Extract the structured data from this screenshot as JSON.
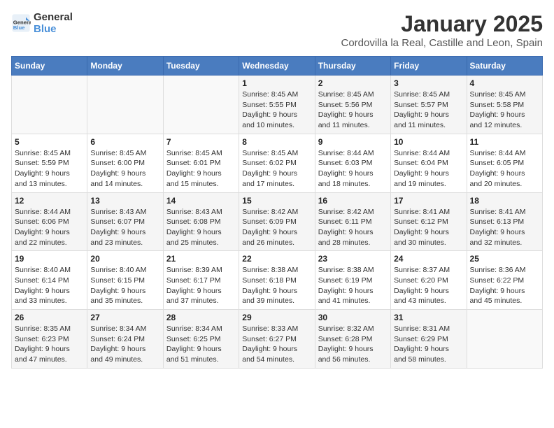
{
  "logo": {
    "line1": "General",
    "line2": "Blue"
  },
  "title": "January 2025",
  "subtitle": "Cordovilla la Real, Castille and Leon, Spain",
  "weekdays": [
    "Sunday",
    "Monday",
    "Tuesday",
    "Wednesday",
    "Thursday",
    "Friday",
    "Saturday"
  ],
  "weeks": [
    [
      {
        "day": "",
        "content": ""
      },
      {
        "day": "",
        "content": ""
      },
      {
        "day": "",
        "content": ""
      },
      {
        "day": "1",
        "content": "Sunrise: 8:45 AM\nSunset: 5:55 PM\nDaylight: 9 hours\nand 10 minutes."
      },
      {
        "day": "2",
        "content": "Sunrise: 8:45 AM\nSunset: 5:56 PM\nDaylight: 9 hours\nand 11 minutes."
      },
      {
        "day": "3",
        "content": "Sunrise: 8:45 AM\nSunset: 5:57 PM\nDaylight: 9 hours\nand 11 minutes."
      },
      {
        "day": "4",
        "content": "Sunrise: 8:45 AM\nSunset: 5:58 PM\nDaylight: 9 hours\nand 12 minutes."
      }
    ],
    [
      {
        "day": "5",
        "content": "Sunrise: 8:45 AM\nSunset: 5:59 PM\nDaylight: 9 hours\nand 13 minutes."
      },
      {
        "day": "6",
        "content": "Sunrise: 8:45 AM\nSunset: 6:00 PM\nDaylight: 9 hours\nand 14 minutes."
      },
      {
        "day": "7",
        "content": "Sunrise: 8:45 AM\nSunset: 6:01 PM\nDaylight: 9 hours\nand 15 minutes."
      },
      {
        "day": "8",
        "content": "Sunrise: 8:45 AM\nSunset: 6:02 PM\nDaylight: 9 hours\nand 17 minutes."
      },
      {
        "day": "9",
        "content": "Sunrise: 8:44 AM\nSunset: 6:03 PM\nDaylight: 9 hours\nand 18 minutes."
      },
      {
        "day": "10",
        "content": "Sunrise: 8:44 AM\nSunset: 6:04 PM\nDaylight: 9 hours\nand 19 minutes."
      },
      {
        "day": "11",
        "content": "Sunrise: 8:44 AM\nSunset: 6:05 PM\nDaylight: 9 hours\nand 20 minutes."
      }
    ],
    [
      {
        "day": "12",
        "content": "Sunrise: 8:44 AM\nSunset: 6:06 PM\nDaylight: 9 hours\nand 22 minutes."
      },
      {
        "day": "13",
        "content": "Sunrise: 8:43 AM\nSunset: 6:07 PM\nDaylight: 9 hours\nand 23 minutes."
      },
      {
        "day": "14",
        "content": "Sunrise: 8:43 AM\nSunset: 6:08 PM\nDaylight: 9 hours\nand 25 minutes."
      },
      {
        "day": "15",
        "content": "Sunrise: 8:42 AM\nSunset: 6:09 PM\nDaylight: 9 hours\nand 26 minutes."
      },
      {
        "day": "16",
        "content": "Sunrise: 8:42 AM\nSunset: 6:11 PM\nDaylight: 9 hours\nand 28 minutes."
      },
      {
        "day": "17",
        "content": "Sunrise: 8:41 AM\nSunset: 6:12 PM\nDaylight: 9 hours\nand 30 minutes."
      },
      {
        "day": "18",
        "content": "Sunrise: 8:41 AM\nSunset: 6:13 PM\nDaylight: 9 hours\nand 32 minutes."
      }
    ],
    [
      {
        "day": "19",
        "content": "Sunrise: 8:40 AM\nSunset: 6:14 PM\nDaylight: 9 hours\nand 33 minutes."
      },
      {
        "day": "20",
        "content": "Sunrise: 8:40 AM\nSunset: 6:15 PM\nDaylight: 9 hours\nand 35 minutes."
      },
      {
        "day": "21",
        "content": "Sunrise: 8:39 AM\nSunset: 6:17 PM\nDaylight: 9 hours\nand 37 minutes."
      },
      {
        "day": "22",
        "content": "Sunrise: 8:38 AM\nSunset: 6:18 PM\nDaylight: 9 hours\nand 39 minutes."
      },
      {
        "day": "23",
        "content": "Sunrise: 8:38 AM\nSunset: 6:19 PM\nDaylight: 9 hours\nand 41 minutes."
      },
      {
        "day": "24",
        "content": "Sunrise: 8:37 AM\nSunset: 6:20 PM\nDaylight: 9 hours\nand 43 minutes."
      },
      {
        "day": "25",
        "content": "Sunrise: 8:36 AM\nSunset: 6:22 PM\nDaylight: 9 hours\nand 45 minutes."
      }
    ],
    [
      {
        "day": "26",
        "content": "Sunrise: 8:35 AM\nSunset: 6:23 PM\nDaylight: 9 hours\nand 47 minutes."
      },
      {
        "day": "27",
        "content": "Sunrise: 8:34 AM\nSunset: 6:24 PM\nDaylight: 9 hours\nand 49 minutes."
      },
      {
        "day": "28",
        "content": "Sunrise: 8:34 AM\nSunset: 6:25 PM\nDaylight: 9 hours\nand 51 minutes."
      },
      {
        "day": "29",
        "content": "Sunrise: 8:33 AM\nSunset: 6:27 PM\nDaylight: 9 hours\nand 54 minutes."
      },
      {
        "day": "30",
        "content": "Sunrise: 8:32 AM\nSunset: 6:28 PM\nDaylight: 9 hours\nand 56 minutes."
      },
      {
        "day": "31",
        "content": "Sunrise: 8:31 AM\nSunset: 6:29 PM\nDaylight: 9 hours\nand 58 minutes."
      },
      {
        "day": "",
        "content": ""
      }
    ]
  ]
}
